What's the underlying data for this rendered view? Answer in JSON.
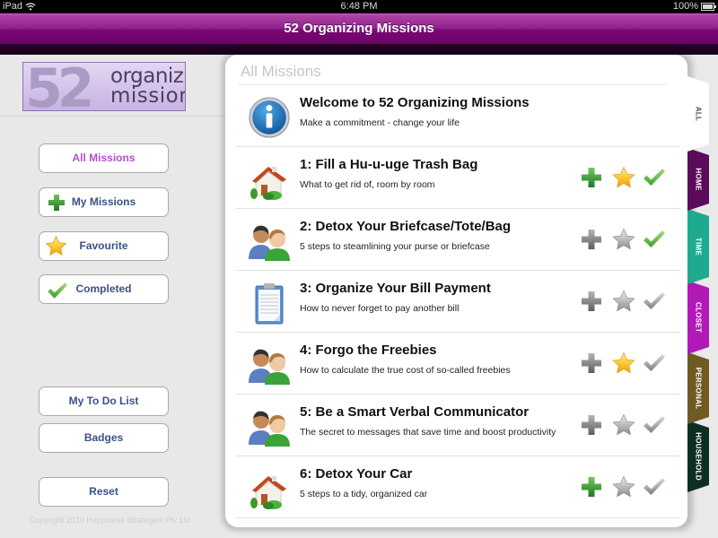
{
  "status_bar": {
    "carrier": "iPad",
    "time": "6:48 PM",
    "battery": "100%"
  },
  "nav_bar": {
    "title": "52 Organizing Missions"
  },
  "sidebar": {
    "logo": {
      "number": "52",
      "line1": "organizing",
      "line2": "missions"
    },
    "filters": [
      {
        "label": "All Missions",
        "icon": "none",
        "active": true
      },
      {
        "label": "My Missions",
        "icon": "plus-icon",
        "active": false
      },
      {
        "label": "Favourite",
        "icon": "star-icon",
        "active": false
      },
      {
        "label": "Completed",
        "icon": "check-icon",
        "active": false
      }
    ],
    "todo_label": "My To Do List",
    "badges_label": "Badges",
    "reset_label": "Reset",
    "copyright": "Copyright 2010 Happiness Strategies Pty Ltd"
  },
  "panel": {
    "heading": "All Missions",
    "welcome": {
      "title": "Welcome to 52 Organizing Missions",
      "subtitle": "Make a commitment - change your life",
      "icon": "info-icon"
    },
    "missions": [
      {
        "title": "1: Fill a Hu-u-uge Trash Bag",
        "subtitle": "What to get rid of, room by room",
        "icon": "house-icon",
        "added": true,
        "favourite": true,
        "completed": true
      },
      {
        "title": "2: Detox Your Briefcase/Tote/Bag",
        "subtitle": "5 steps to steamlining your purse or briefcase",
        "icon": "people-icon",
        "added": false,
        "favourite": false,
        "completed": true
      },
      {
        "title": "3: Organize Your Bill Payment",
        "subtitle": "How to never forget to pay another bill",
        "icon": "clipboard-icon",
        "added": false,
        "favourite": false,
        "completed": false
      },
      {
        "title": "4: Forgo the Freebies",
        "subtitle": "How to calculate the true cost of so-called freebies",
        "icon": "people-icon",
        "added": false,
        "favourite": true,
        "completed": false
      },
      {
        "title": "5: Be a Smart Verbal Communicator",
        "subtitle": "The secret to messages that save time and boost productivity",
        "icon": "people-icon",
        "added": false,
        "favourite": false,
        "completed": false
      },
      {
        "title": "6: Detox Your Car",
        "subtitle": "5 steps to a tidy, organized car",
        "icon": "house-icon",
        "added": true,
        "favourite": false,
        "completed": false
      }
    ]
  },
  "category_tabs": [
    {
      "label": "ALL",
      "color": "#ffffff",
      "active": true
    },
    {
      "label": "HOME",
      "color": "#5c0a5a",
      "active": false
    },
    {
      "label": "TIME",
      "color": "#1fa98f",
      "active": false
    },
    {
      "label": "CLOSET",
      "color": "#b21ab8",
      "active": false
    },
    {
      "label": "PERSONAL",
      "color": "#6f5a22",
      "active": false
    },
    {
      "label": "HOUSEHOLD",
      "color": "#0e2e24",
      "active": false
    }
  ],
  "colors": {
    "nav_purple": "#7d0c78",
    "active_filter_text": "#b34fd0",
    "button_text": "#3a5287",
    "plus_active": "#3c9a3a",
    "star_active": "#f6c020",
    "check_active": "#5fb043",
    "inactive_icon": "#8e8e8e"
  }
}
